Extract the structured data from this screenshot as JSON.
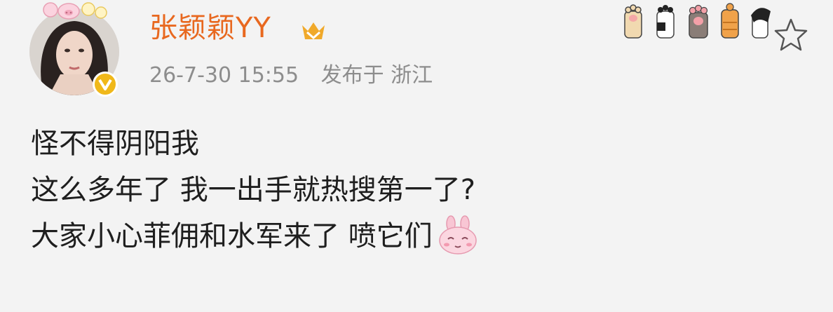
{
  "user": {
    "name": "张颖颖YY",
    "colors": {
      "name": "#e8681f",
      "badge": "#f0b81a"
    }
  },
  "meta": {
    "time": "26-7-30 15:55",
    "location": "发布于 浙江"
  },
  "post": {
    "lines": [
      "怪不得阴阳我",
      "这么多年了 我一出手就热搜第一了?",
      "大家小心菲佣和水军来了 喷它们"
    ],
    "emoji": "pink-bunny-emoji"
  },
  "icons": {
    "avatar_frame": "pig-ears-frame-icon",
    "vip": "vip-crown-icon",
    "paws": "cat-paws-decoration-icon",
    "favorite": "star-icon"
  }
}
